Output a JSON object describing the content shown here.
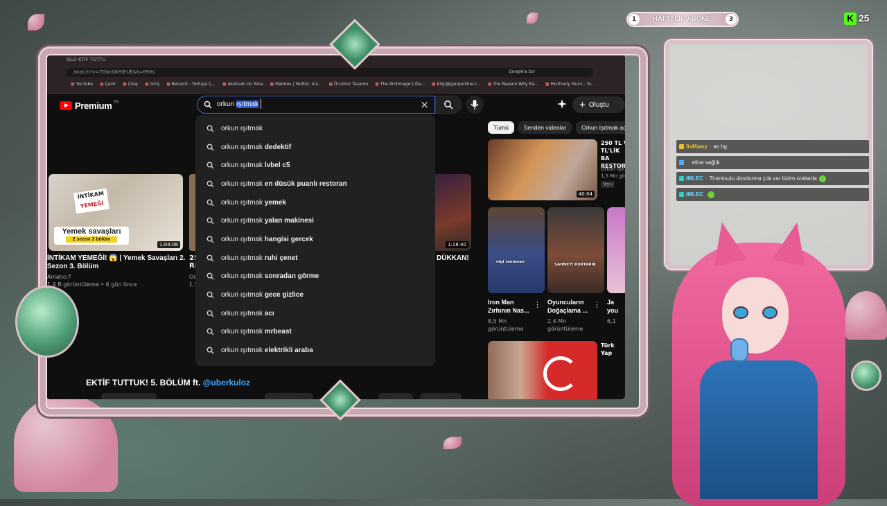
{
  "browser": {
    "tab_title": "OLD KTIF TUTTU",
    "url": "/watch?v=7DbnOk9lEUE&t=690s",
    "google_button": "Google'a Sor",
    "bookmarks": [
      "YouTube",
      "Çevir",
      "Çılaş",
      "Giriş",
      "Berserk - Tortuga Ç...",
      "Akatsuki no Yona",
      "Maimes | Twitter, Ins...",
      "Ücretsiz Tasarım",
      "The Archmage's Da...",
      "bilgi@garajonline.c...",
      "The Reason Why Ra...",
      "Positively Yours - To..."
    ]
  },
  "youtube": {
    "logo": "Premium",
    "logo_region": "TR",
    "search": {
      "query_prefix": "orkun ",
      "query_selected": "ışıtmak"
    },
    "create_label": "Oluştu",
    "suggestions": [
      {
        "q": "orkun ışıtmak",
        "rest": ""
      },
      {
        "q": "orkun ışıtmak",
        "rest": "dedektif"
      },
      {
        "q": "orkun ışıtmak",
        "rest": "lvbel c5"
      },
      {
        "q": "orkun ışıtmak",
        "rest": "en düsük puanlı restoran"
      },
      {
        "q": "orkun ışıtmak",
        "rest": "yemek"
      },
      {
        "q": "orkun ışıtmak",
        "rest": "yalan makinesi"
      },
      {
        "q": "orkun ışıtmak",
        "rest": "hangisi gercek"
      },
      {
        "q": "orkun ışıtmak",
        "rest": "ruhi çenet"
      },
      {
        "q": "orkun ışıtmak",
        "rest": "sonradan görme"
      },
      {
        "q": "orkun ışıtmak",
        "rest": "gece gizlice"
      },
      {
        "q": "orkun ışıtmak",
        "rest": "acı"
      },
      {
        "q": "orkun ışıtmak",
        "rest": "mrbeast"
      },
      {
        "q": "orkun ışıtmak",
        "rest": "elektrikli araba"
      }
    ],
    "main_video": {
      "thumb_word1": "İNTİKAM",
      "thumb_word2": "YEMEĞİ",
      "banner": "Yemek savaşları",
      "banner_sub": "2 sezon 3 bölüm",
      "duration": "1:04:08",
      "title": "İNTİKAM YEMEĞİ! 😱 | Yemek Savaşları 2. Sezon 3. Bölüm",
      "channel": "Anlatıcı7",
      "meta": "1,4 B görüntüleme • 6 gün önce"
    },
    "mid_video": {
      "title": "25",
      "title2": "Ri",
      "meta": "Or",
      "meta2": "1,5"
    },
    "right_video": {
      "duration": "1:18:40",
      "title": "N DÜKKAN!"
    },
    "bottom_title": "EKTİF TUTTUK! 5. BÖLÜM ft.",
    "bottom_mention": "@uberkuloz",
    "chips": [
      "Tümü",
      "Seriden videolar",
      "Orkun Işıtmak adl"
    ],
    "side_top": {
      "title": "250 TL V TL'LİK BA RESTORA",
      "channel": "Orkun Işıt",
      "views": "1,5 Mn gö",
      "badge": "Yeni",
      "duration": "40:04"
    },
    "shorts": [
      {
        "title": "Iron Man Zırhının Nas...",
        "views": "8,5 Mn",
        "views2": "görüntüleme",
        "overlay": "elgi ranlanan"
      },
      {
        "title": "Oyuncuların Doğaçlama ...",
        "views": "2,4 Mn",
        "views2": "görüntüleme",
        "overlay": "SAHNEYİ KURTARIR"
      },
      {
        "title": "Ja you",
        "views": "6,1",
        "views2": "",
        "overlay": ""
      }
    ],
    "side_bottom": {
      "title": "Türk Yap"
    }
  },
  "stream": {
    "sub_goal": {
      "left": "1",
      "label": "HAFTALIK ABONE",
      "right": "3"
    },
    "kick_logo": "K",
    "viewers": "25",
    "chat": [
      {
        "user": "0xMawy",
        "text": "as hg",
        "user_color": "#f0c020",
        "badge_color": "#f0c020",
        "emote": false
      },
      {
        "user": "",
        "text": "eline sağlık",
        "user_color": "#ff4040",
        "badge_color": "#4ab0ff",
        "emote": false
      },
      {
        "user": "IMLEC",
        "text": "Tiramisulu dondurma çok var bizim oralarda",
        "user_color": "#69e0ff",
        "badge_color": "#2bd1c9",
        "emote": true
      },
      {
        "user": "IMLEC",
        "text": "",
        "user_color": "#69e0ff",
        "badge_color": "#2bd1c9",
        "emote": true
      }
    ]
  }
}
